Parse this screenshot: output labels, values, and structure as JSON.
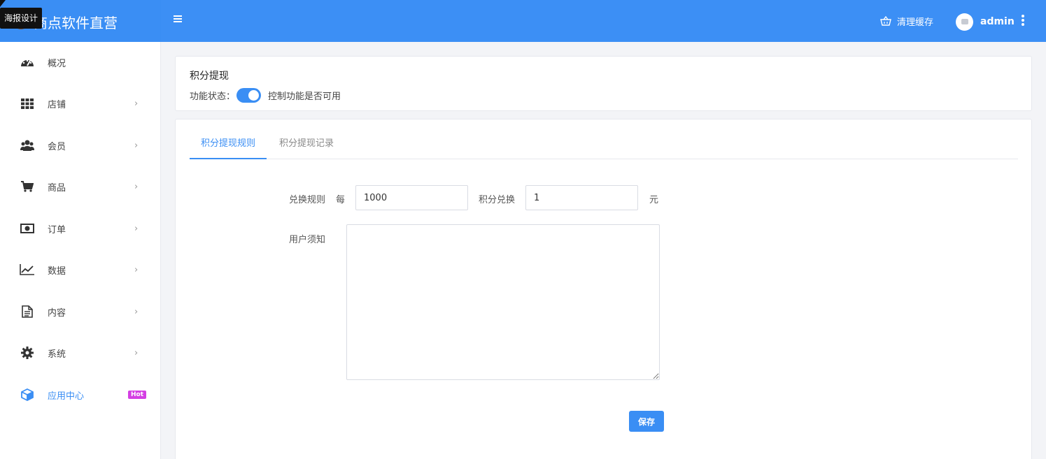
{
  "header": {
    "brand_name": "商点软件直营",
    "tooltip": "海报设计",
    "clear_cache_label": "清理缓存",
    "user_name": "admin",
    "accent_color": "#3c8ff5"
  },
  "sidebar": {
    "items": [
      {
        "label": "概况",
        "icon": "dashboard-icon",
        "chevron": ""
      },
      {
        "label": "店铺",
        "icon": "grid-icon",
        "chevron": "›"
      },
      {
        "label": "会员",
        "icon": "users-icon",
        "chevron": "›"
      },
      {
        "label": "商品",
        "icon": "cart-icon",
        "chevron": "›"
      },
      {
        "label": "订单",
        "icon": "money-icon",
        "chevron": "›"
      },
      {
        "label": "数据",
        "icon": "chart-line-icon",
        "chevron": "›"
      },
      {
        "label": "内容",
        "icon": "document-icon",
        "chevron": "›"
      },
      {
        "label": "系统",
        "icon": "gear-icon",
        "chevron": "›"
      },
      {
        "label": "应用中心",
        "icon": "cube-icon",
        "badge": "Hot"
      }
    ]
  },
  "feature": {
    "title": "积分提现",
    "status_label": "功能状态：",
    "status_on": true,
    "status_desc": "控制功能是否可用"
  },
  "tabs": [
    {
      "label": "积分提现规则",
      "active": true
    },
    {
      "label": "积分提现记录",
      "active": false
    }
  ],
  "form": {
    "rule_label": "兑换规则",
    "per_label": "每",
    "points_value": "1000",
    "exchange_label": "积分兑换",
    "yuan_value": "1",
    "yuan_unit": "元",
    "notice_label": "用户须知",
    "notice_value": "",
    "save_label": "保存"
  }
}
